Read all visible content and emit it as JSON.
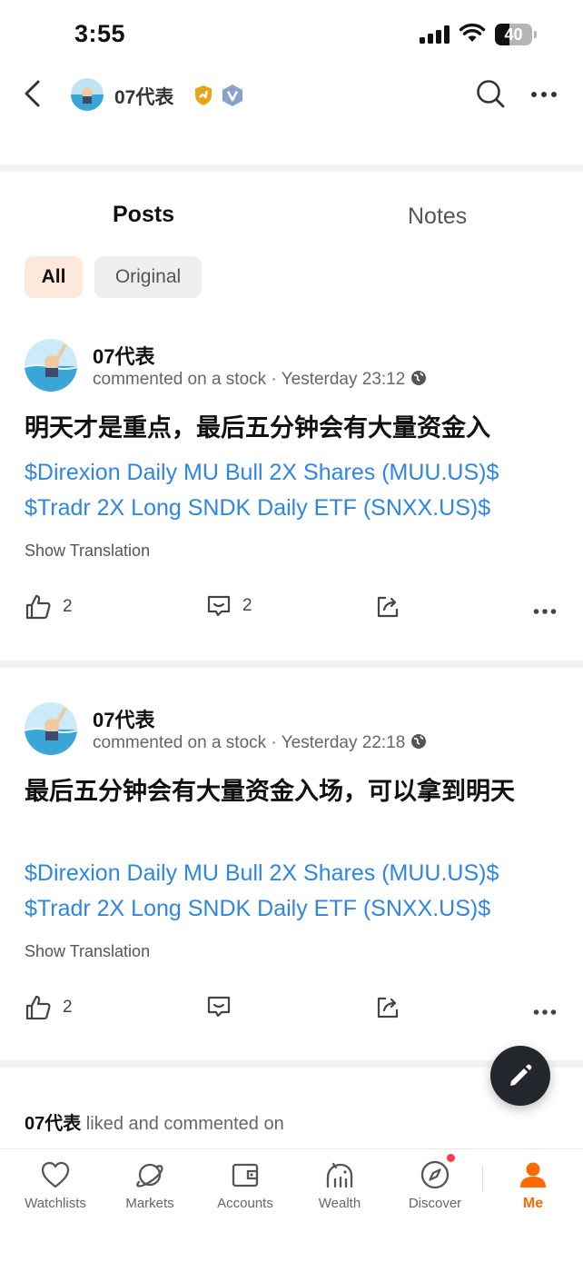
{
  "status_bar": {
    "time": "3:55",
    "battery": "40",
    "battery_level": 0.4
  },
  "header": {
    "profile_name": "07代表"
  },
  "tabs": [
    {
      "label": "Posts"
    },
    {
      "label": "Notes"
    }
  ],
  "filters": [
    {
      "label": "All"
    },
    {
      "label": "Original"
    }
  ],
  "posts": [
    {
      "author": "07代表",
      "meta": "commented on a stock · Yesterday 23:12",
      "title": "明天才是重点，最后五分钟会有大量资金入",
      "links": [
        "$Direxion Daily MU Bull 2X Shares (MUU.US)$",
        "$Tradr 2X Long SNDK Daily ETF (SNXX.US)$"
      ],
      "translate_label": "Show Translation",
      "likes": "2",
      "comments": "2"
    },
    {
      "author": "07代表",
      "meta": "commented on a stock · Yesterday 22:18",
      "title": "最后五分钟会有大量资金入场，可以拿到明天",
      "links": [
        "$Direxion Daily MU Bull 2X Shares (MUU.US)$",
        "$Tradr 2X Long SNDK Daily ETF (SNXX.US)$"
      ],
      "translate_label": "Show Translation",
      "likes": "2",
      "comments": ""
    }
  ],
  "activity": {
    "author": "07代表",
    "text": " liked and commented on"
  },
  "bottom_nav": [
    {
      "label": "Watchlists",
      "icon": "heart-icon"
    },
    {
      "label": "Markets",
      "icon": "planet-icon"
    },
    {
      "label": "Accounts",
      "icon": "wallet-icon"
    },
    {
      "label": "Wealth",
      "icon": "piggy-bank-icon"
    },
    {
      "label": "Discover",
      "icon": "compass-icon"
    },
    {
      "label": "Me",
      "icon": "person-icon"
    }
  ],
  "colors": {
    "accent": "#ff6a00",
    "link": "#2f86e0",
    "fab": "#23262d"
  }
}
